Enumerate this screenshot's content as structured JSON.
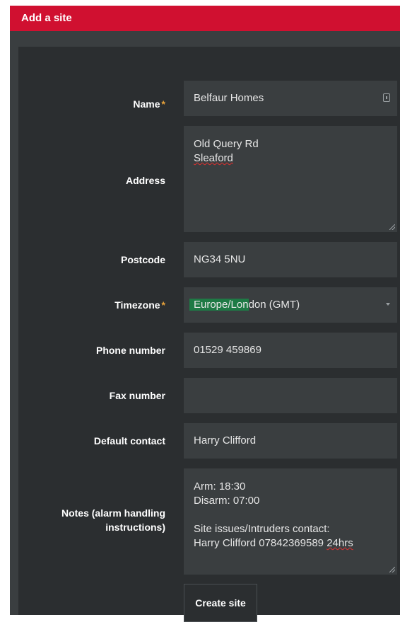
{
  "title": "Add a site",
  "form": {
    "name": {
      "label": "Name",
      "required": true,
      "value": "Belfaur Homes"
    },
    "address": {
      "label": "Address",
      "lines": [
        "Old Query Rd",
        "Sleaford"
      ]
    },
    "postcode": {
      "label": "Postcode",
      "value": "NG34 5NU"
    },
    "timezone": {
      "label": "Timezone",
      "required": true,
      "value_highlighted": "Europe/Lon",
      "value_rest": "don (GMT)"
    },
    "phone": {
      "label": "Phone number",
      "value": "01529 459869"
    },
    "fax": {
      "label": "Fax number",
      "value": ""
    },
    "default_contact": {
      "label": "Default contact",
      "value": "Harry Clifford"
    },
    "notes": {
      "label_line1": "Notes (alarm handling",
      "label_line2": "instructions)",
      "line1": "Arm: 18:30",
      "line2": "Disarm: 07:00",
      "line3": "",
      "line4": "Site issues/Intruders contact:",
      "line5_main": "Harry Clifford 07842369589 ",
      "line5_misspelled": "24hrs"
    },
    "submit_label": "Create site"
  },
  "colors": {
    "header_red": "#d01030",
    "required_star": "#e8a23a",
    "highlight_green": "#1e7a45"
  }
}
